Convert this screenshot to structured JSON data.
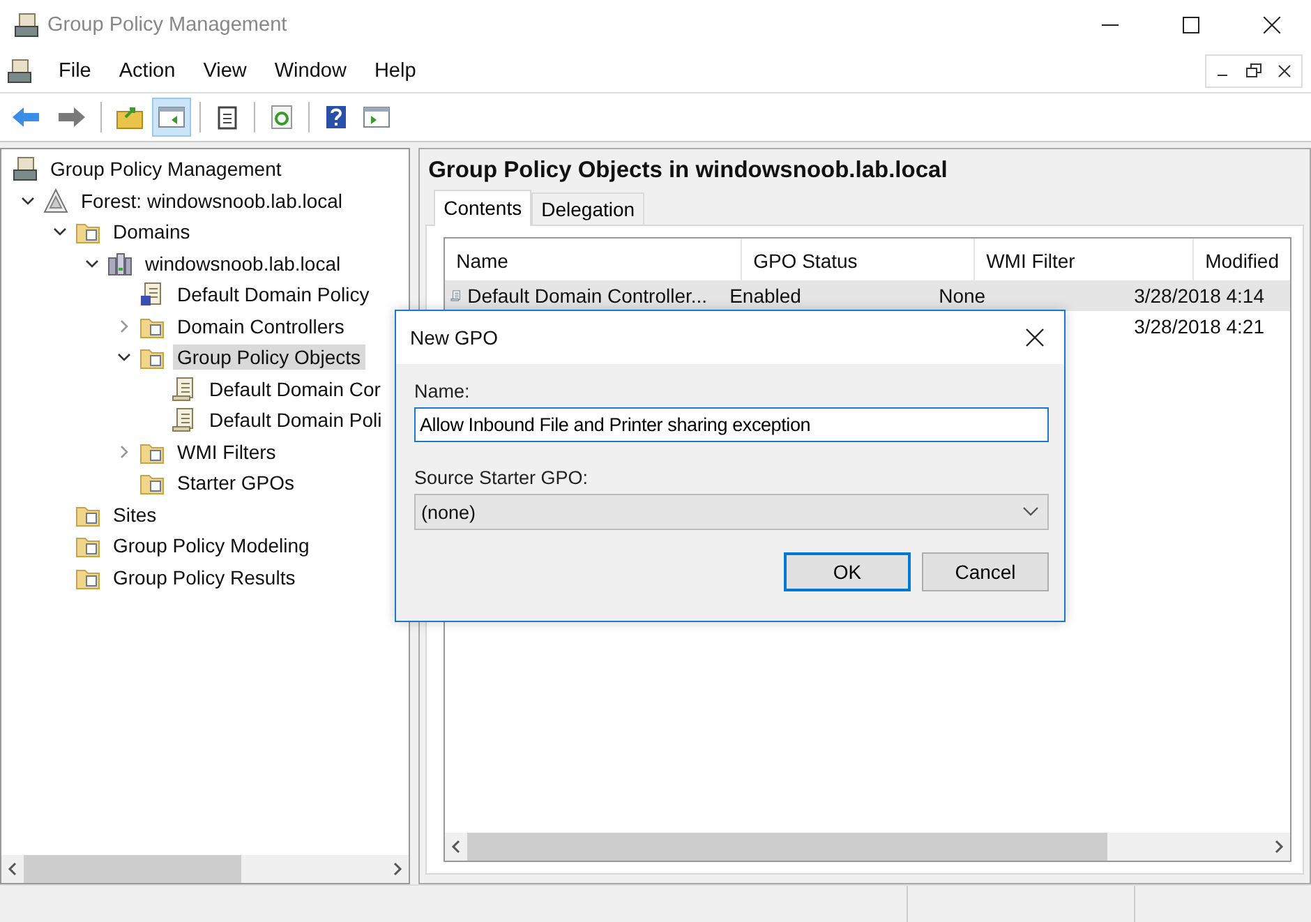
{
  "window": {
    "title": "Group Policy Management"
  },
  "menu": [
    "File",
    "Action",
    "View",
    "Window",
    "Help"
  ],
  "toolbar": [
    [
      {
        "kind": "back",
        "selected": false
      },
      {
        "kind": "forward",
        "selected": false
      }
    ],
    [
      {
        "kind": "up",
        "selected": false
      },
      {
        "kind": "tree",
        "selected": true
      }
    ],
    [
      {
        "kind": "properties",
        "selected": false
      }
    ],
    [
      {
        "kind": "refresh",
        "selected": false
      }
    ],
    [
      {
        "kind": "help",
        "selected": false
      },
      {
        "kind": "actionpane",
        "selected": false
      }
    ]
  ],
  "tree": [
    {
      "label": "Group Policy Management",
      "kind": "console",
      "selected": false,
      "children": [
        {
          "label": "Forest: windowsnoob.lab.local",
          "kind": "forest",
          "selected": false,
          "expanded": true,
          "children": [
            {
              "label": "Domains",
              "kind": "folder",
              "selected": false,
              "expanded": true,
              "children": [
                {
                  "label": "windowsnoob.lab.local",
                  "kind": "domain",
                  "selected": false,
                  "expanded": true,
                  "children": [
                    {
                      "label": "Default Domain Policy",
                      "kind": "link",
                      "selected": false
                    },
                    {
                      "label": "Domain Controllers",
                      "kind": "folder",
                      "selected": false,
                      "expanded": false
                    },
                    {
                      "label": "Group Policy Objects",
                      "kind": "folder",
                      "selected": true,
                      "expanded": true,
                      "children": [
                        {
                          "label": "Default Domain Cor",
                          "kind": "scroll",
                          "selected": false
                        },
                        {
                          "label": "Default Domain Poli",
                          "kind": "scroll",
                          "selected": false
                        }
                      ]
                    },
                    {
                      "label": "WMI Filters",
                      "kind": "folder",
                      "selected": false,
                      "expanded": false
                    },
                    {
                      "label": "Starter GPOs",
                      "kind": "folder",
                      "selected": false
                    }
                  ]
                }
              ]
            },
            {
              "label": "Sites",
              "kind": "folder",
              "selected": false
            },
            {
              "label": "Group Policy Modeling",
              "kind": "folder",
              "selected": false
            },
            {
              "label": "Group Policy Results",
              "kind": "folder",
              "selected": false
            }
          ]
        }
      ]
    }
  ],
  "content": {
    "heading": "Group Policy Objects in windowsnoob.lab.local",
    "tabs": [
      {
        "label": "Contents",
        "selected": true
      },
      {
        "label": "Delegation",
        "selected": false
      }
    ],
    "table": {
      "columns": [
        "Name",
        "GPO Status",
        "WMI Filter",
        "Modified"
      ],
      "rows": [
        {
          "selected": true,
          "name": "Default Domain Controller...",
          "gpo_status": "Enabled",
          "wmi_filter": "None",
          "modified": "3/28/2018 4:14"
        },
        {
          "selected": false,
          "modified": "3/28/2018 4:21"
        }
      ]
    }
  },
  "dialog": {
    "title": "New GPO",
    "name_label": "Name:",
    "name_value": "Allow Inbound File and Printer sharing exception",
    "source_label": "Source Starter GPO:",
    "source_value": "(none)",
    "buttons": [
      {
        "label": "OK",
        "selected": true
      },
      {
        "label": "Cancel",
        "selected": false
      }
    ]
  }
}
